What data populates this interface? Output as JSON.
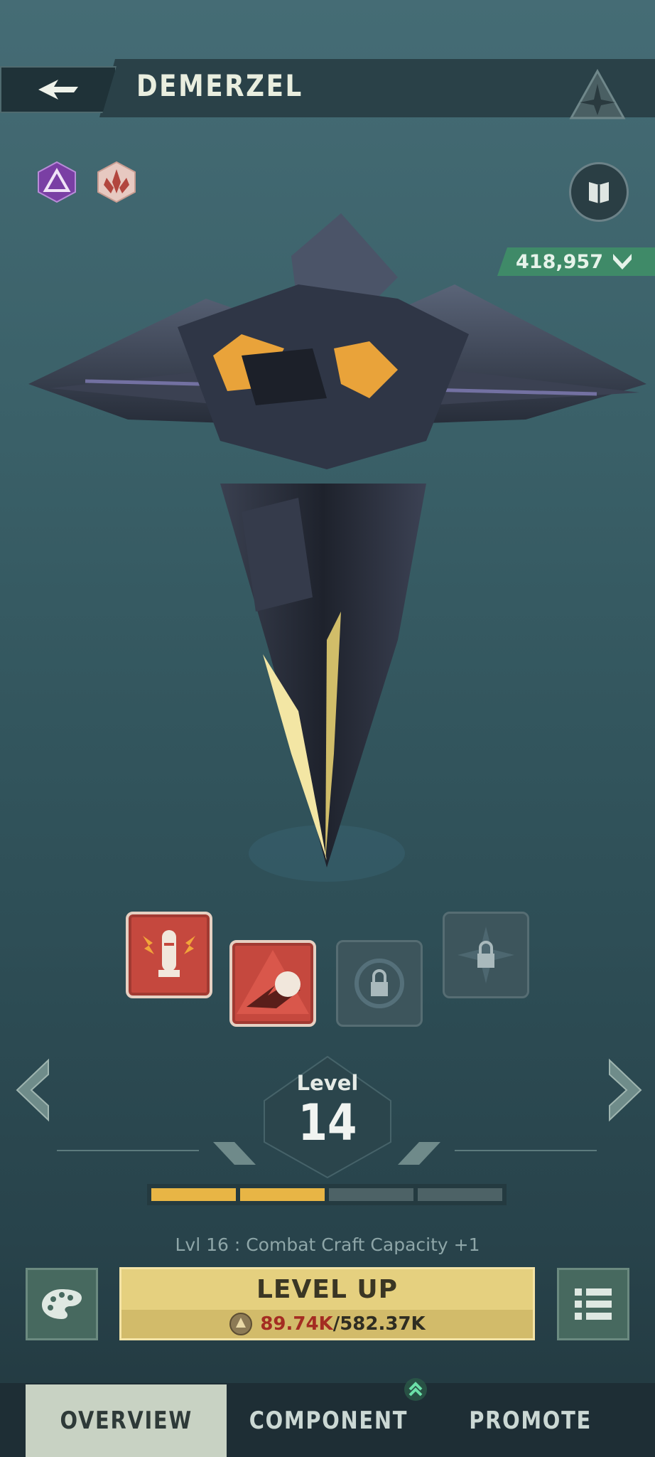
{
  "header": {
    "title": "DEMERZEL"
  },
  "badges": [
    "rarity-epic-badge",
    "faction-crest-badge"
  ],
  "power": {
    "value": "418,957"
  },
  "abilities": [
    {
      "name": "missile-ability",
      "state": "unlocked"
    },
    {
      "name": "impact-blast-ability",
      "state": "unlocked"
    },
    {
      "name": "locked-slot",
      "state": "locked"
    },
    {
      "name": "locked-slot",
      "state": "locked"
    }
  ],
  "level": {
    "label": "Level",
    "value": "14",
    "progress_segments": {
      "filled": 2,
      "total": 4
    },
    "next_unlock": "Lvl 16 : Combat Craft Capacity +1"
  },
  "actions": {
    "level_up_label": "LEVEL UP",
    "cost_current": "89.74K",
    "cost_separator": "/",
    "cost_required": "582.37K"
  },
  "tabs": [
    {
      "label": "OVERVIEW",
      "selected": true
    },
    {
      "label": "COMPONENT",
      "selected": false
    },
    {
      "label": "PROMOTE",
      "selected": false
    }
  ],
  "colors": {
    "accent_yellow": "#e5d07f",
    "power_green": "#3f8a68",
    "ability_red": "#c5483e",
    "progress_fill": "#e8b545",
    "progress_empty": "#4d6266",
    "cost_red": "#a42c22"
  }
}
